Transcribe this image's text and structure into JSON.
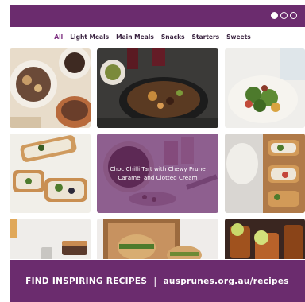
{
  "nav": {
    "tabs": [
      {
        "label": "All",
        "active": true
      },
      {
        "label": "Light Meals",
        "active": false
      },
      {
        "label": "Main Meals",
        "active": false
      },
      {
        "label": "Snacks",
        "active": false
      },
      {
        "label": "Starters",
        "active": false
      },
      {
        "label": "Sweets",
        "active": false
      }
    ]
  },
  "carousel": {
    "page_count": 3,
    "active_index": 0
  },
  "tiles": {
    "hover_caption": "Choc Chilli Tart with Chewy Prune Caramel and Clotted Cream"
  },
  "banner": {
    "text": "FIND INSPIRING RECIPES",
    "separator": "|",
    "url": "ausprunes.org.au/recipes"
  },
  "colors": {
    "brand_purple": "#6b2c6e",
    "nav_text": "#3a2340",
    "nav_active": "#7a2a7e"
  }
}
